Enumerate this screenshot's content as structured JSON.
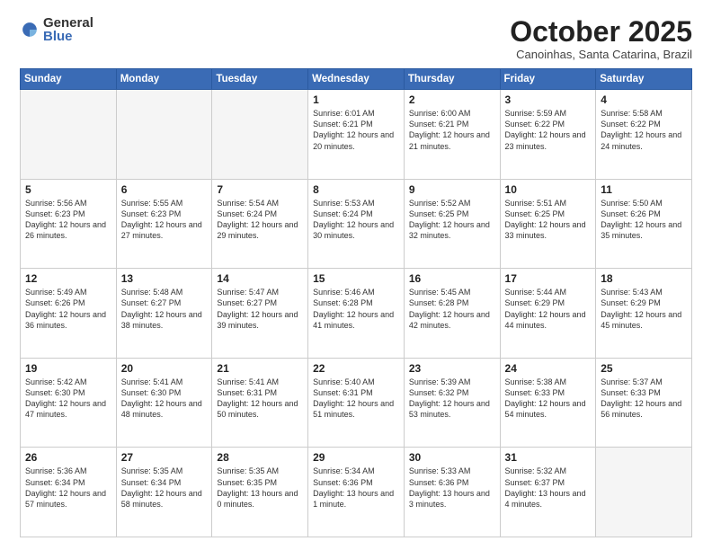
{
  "logo": {
    "general": "General",
    "blue": "Blue"
  },
  "header": {
    "month": "October 2025",
    "location": "Canoinhas, Santa Catarina, Brazil"
  },
  "weekdays": [
    "Sunday",
    "Monday",
    "Tuesday",
    "Wednesday",
    "Thursday",
    "Friday",
    "Saturday"
  ],
  "weeks": [
    [
      {
        "day": "",
        "empty": true
      },
      {
        "day": "",
        "empty": true
      },
      {
        "day": "",
        "empty": true
      },
      {
        "day": "1",
        "sunrise": "6:01 AM",
        "sunset": "6:21 PM",
        "daylight": "12 hours and 20 minutes."
      },
      {
        "day": "2",
        "sunrise": "6:00 AM",
        "sunset": "6:21 PM",
        "daylight": "12 hours and 21 minutes."
      },
      {
        "day": "3",
        "sunrise": "5:59 AM",
        "sunset": "6:22 PM",
        "daylight": "12 hours and 23 minutes."
      },
      {
        "day": "4",
        "sunrise": "5:58 AM",
        "sunset": "6:22 PM",
        "daylight": "12 hours and 24 minutes."
      }
    ],
    [
      {
        "day": "5",
        "sunrise": "5:56 AM",
        "sunset": "6:23 PM",
        "daylight": "12 hours and 26 minutes."
      },
      {
        "day": "6",
        "sunrise": "5:55 AM",
        "sunset": "6:23 PM",
        "daylight": "12 hours and 27 minutes."
      },
      {
        "day": "7",
        "sunrise": "5:54 AM",
        "sunset": "6:24 PM",
        "daylight": "12 hours and 29 minutes."
      },
      {
        "day": "8",
        "sunrise": "5:53 AM",
        "sunset": "6:24 PM",
        "daylight": "12 hours and 30 minutes."
      },
      {
        "day": "9",
        "sunrise": "5:52 AM",
        "sunset": "6:25 PM",
        "daylight": "12 hours and 32 minutes."
      },
      {
        "day": "10",
        "sunrise": "5:51 AM",
        "sunset": "6:25 PM",
        "daylight": "12 hours and 33 minutes."
      },
      {
        "day": "11",
        "sunrise": "5:50 AM",
        "sunset": "6:26 PM",
        "daylight": "12 hours and 35 minutes."
      }
    ],
    [
      {
        "day": "12",
        "sunrise": "5:49 AM",
        "sunset": "6:26 PM",
        "daylight": "12 hours and 36 minutes."
      },
      {
        "day": "13",
        "sunrise": "5:48 AM",
        "sunset": "6:27 PM",
        "daylight": "12 hours and 38 minutes."
      },
      {
        "day": "14",
        "sunrise": "5:47 AM",
        "sunset": "6:27 PM",
        "daylight": "12 hours and 39 minutes."
      },
      {
        "day": "15",
        "sunrise": "5:46 AM",
        "sunset": "6:28 PM",
        "daylight": "12 hours and 41 minutes."
      },
      {
        "day": "16",
        "sunrise": "5:45 AM",
        "sunset": "6:28 PM",
        "daylight": "12 hours and 42 minutes."
      },
      {
        "day": "17",
        "sunrise": "5:44 AM",
        "sunset": "6:29 PM",
        "daylight": "12 hours and 44 minutes."
      },
      {
        "day": "18",
        "sunrise": "5:43 AM",
        "sunset": "6:29 PM",
        "daylight": "12 hours and 45 minutes."
      }
    ],
    [
      {
        "day": "19",
        "sunrise": "5:42 AM",
        "sunset": "6:30 PM",
        "daylight": "12 hours and 47 minutes."
      },
      {
        "day": "20",
        "sunrise": "5:41 AM",
        "sunset": "6:30 PM",
        "daylight": "12 hours and 48 minutes."
      },
      {
        "day": "21",
        "sunrise": "5:41 AM",
        "sunset": "6:31 PM",
        "daylight": "12 hours and 50 minutes."
      },
      {
        "day": "22",
        "sunrise": "5:40 AM",
        "sunset": "6:31 PM",
        "daylight": "12 hours and 51 minutes."
      },
      {
        "day": "23",
        "sunrise": "5:39 AM",
        "sunset": "6:32 PM",
        "daylight": "12 hours and 53 minutes."
      },
      {
        "day": "24",
        "sunrise": "5:38 AM",
        "sunset": "6:33 PM",
        "daylight": "12 hours and 54 minutes."
      },
      {
        "day": "25",
        "sunrise": "5:37 AM",
        "sunset": "6:33 PM",
        "daylight": "12 hours and 56 minutes."
      }
    ],
    [
      {
        "day": "26",
        "sunrise": "5:36 AM",
        "sunset": "6:34 PM",
        "daylight": "12 hours and 57 minutes."
      },
      {
        "day": "27",
        "sunrise": "5:35 AM",
        "sunset": "6:34 PM",
        "daylight": "12 hours and 58 minutes."
      },
      {
        "day": "28",
        "sunrise": "5:35 AM",
        "sunset": "6:35 PM",
        "daylight": "13 hours and 0 minutes."
      },
      {
        "day": "29",
        "sunrise": "5:34 AM",
        "sunset": "6:36 PM",
        "daylight": "13 hours and 1 minute."
      },
      {
        "day": "30",
        "sunrise": "5:33 AM",
        "sunset": "6:36 PM",
        "daylight": "13 hours and 3 minutes."
      },
      {
        "day": "31",
        "sunrise": "5:32 AM",
        "sunset": "6:37 PM",
        "daylight": "13 hours and 4 minutes."
      },
      {
        "day": "",
        "empty": true
      }
    ]
  ]
}
